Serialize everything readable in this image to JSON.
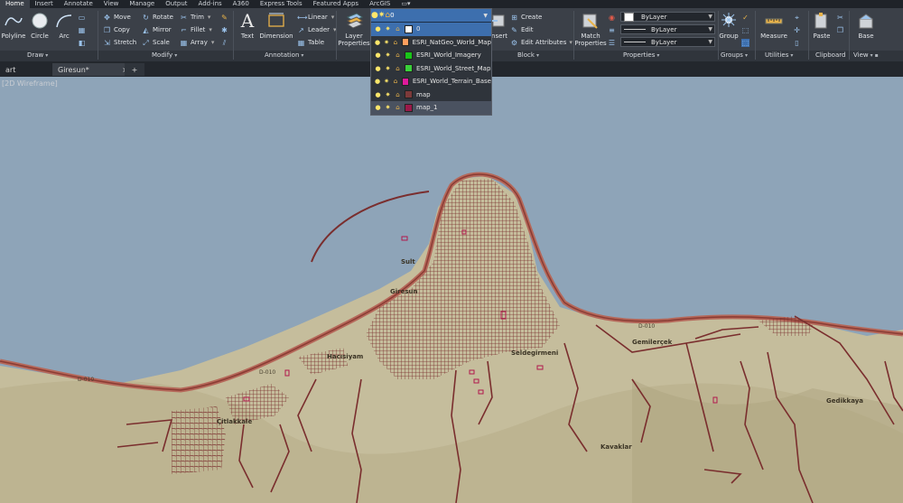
{
  "menu": [
    "Home",
    "Insert",
    "Annotate",
    "View",
    "Manage",
    "Output",
    "Add-ins",
    "A360",
    "Express Tools",
    "Featured Apps",
    "ArcGIS"
  ],
  "ribbon": {
    "draw": {
      "polyline": "Polyline",
      "circle": "Circle",
      "arc": "Arc",
      "panel": "Draw"
    },
    "modify": {
      "move": "Move",
      "copy": "Copy",
      "stretch": "Stretch",
      "rotate": "Rotate",
      "mirror": "Mirror",
      "scale": "Scale",
      "trim": "Trim",
      "fillet": "Fillet",
      "array": "Array",
      "panel": "Modify"
    },
    "annotation": {
      "text": "Text",
      "dimension": "Dimension",
      "linear": "Linear",
      "leader": "Leader",
      "table": "Table",
      "panel": "Annotation"
    },
    "layers": {
      "layer_properties": "Layer\nProperties",
      "current_layer": "0"
    },
    "block": {
      "insert": "Insert",
      "create": "Create",
      "edit": "Edit",
      "edit_attributes": "Edit Attributes",
      "panel": "Block"
    },
    "properties": {
      "match": "Match\nProperties",
      "color": "ByLayer",
      "linetype": "ByLayer",
      "lineweight": "ByLayer",
      "panel": "Properties"
    },
    "groups": {
      "group": "Group",
      "panel": "Groups"
    },
    "utilities": {
      "measure": "Measure",
      "panel": "Utilities"
    },
    "clipboard": {
      "paste": "Paste",
      "panel": "Clipboard"
    },
    "view": {
      "base": "Base",
      "panel": "View"
    }
  },
  "doc_tabs": {
    "start": "art",
    "active": "Giresun*",
    "add": "+"
  },
  "viewport_label": "[2D Wireframe]",
  "layer_dropdown": {
    "current": "0",
    "layers": [
      {
        "name": "0",
        "color": "#ffffff"
      },
      {
        "name": "ESRI_NatGeo_World_Map",
        "color": "#ff9e5e"
      },
      {
        "name": "ESRI_World_Imagery",
        "color": "#19c419"
      },
      {
        "name": "ESRI_World_Street_Map",
        "color": "#3ad13a"
      },
      {
        "name": "ESRI_World_Terrain_Base",
        "color": "#e01a9c"
      },
      {
        "name": "map",
        "color": "#7d3a3a"
      },
      {
        "name": "map_1",
        "color": "#9b1a4a"
      }
    ],
    "selected_index": 6
  },
  "map_labels": {
    "sultan": "Sult",
    "giresun": "Giresun",
    "hacisiyam": "Hacısiyam",
    "seldegirmeni": "Seldegirmeni",
    "gemilercek": "Gemilerçek",
    "citlakkale": "Çitlakkale",
    "gedikkaya": "Gedikkaya",
    "kavaklar": "Kavaklar",
    "d010a": "D-010",
    "d010b": "D-010",
    "d010c": "D-010"
  },
  "colors": {
    "sea": "#8ea4b8",
    "land": "#c7c0a0",
    "roads": "#7a2e2e",
    "highway": "#b5685a",
    "accent": "#3d6fae"
  }
}
